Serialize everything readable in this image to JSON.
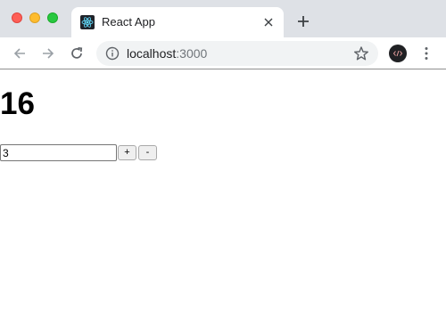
{
  "browser": {
    "tab": {
      "title": "React App",
      "favicon": "react-logo-icon"
    },
    "new_tab_icon": "plus-icon",
    "nav": {
      "back_icon": "arrow-left-icon",
      "forward_icon": "arrow-right-icon",
      "reload_icon": "reload-icon"
    },
    "address_bar": {
      "host": "localhost",
      "port": ":3000",
      "info_icon": "info-icon",
      "bookmark_icon": "star-icon"
    },
    "extension_icon": "code-extension-icon",
    "menu_icon": "kebab-menu-icon",
    "window_controls": [
      "close",
      "minimize",
      "maximize"
    ]
  },
  "app": {
    "counter_value": "16",
    "step_input_value": "3",
    "increment_label": "+",
    "decrement_label": "-"
  },
  "colors": {
    "tabstrip": "#dee1e6",
    "omnibox": "#f1f3f4",
    "react_blue": "#61dafb"
  }
}
